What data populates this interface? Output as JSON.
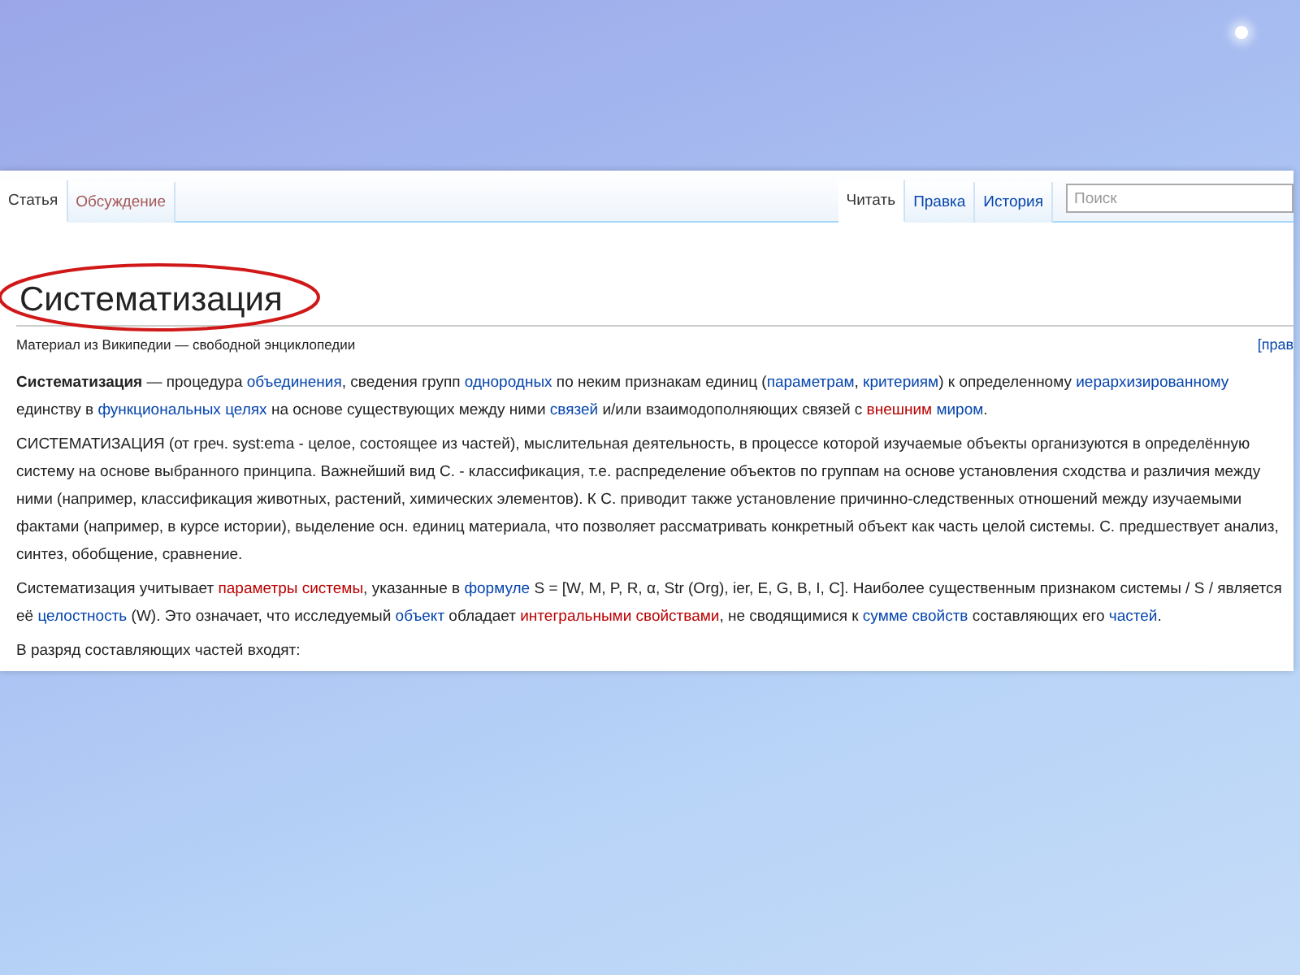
{
  "tabs_left": [
    {
      "label": "Статья",
      "selected": true
    },
    {
      "label": "Обсуждение",
      "selected": false
    }
  ],
  "tabs_right": [
    {
      "label": "Читать",
      "selected": true
    },
    {
      "label": "Правка",
      "selected": false
    },
    {
      "label": "История",
      "selected": false
    }
  ],
  "search": {
    "placeholder": "Поиск"
  },
  "title": "Систематизация",
  "subtitle": "Материал из Википедии — свободной энциклопедии",
  "edit_link": "[прав",
  "paragraphs": [
    [
      {
        "kind": "bold",
        "text": "Систематизация"
      },
      {
        "kind": "plain",
        "text": " — процедура "
      },
      {
        "kind": "link",
        "text": "объединения"
      },
      {
        "kind": "plain",
        "text": ", сведения групп "
      },
      {
        "kind": "link",
        "text": "однородных"
      },
      {
        "kind": "plain",
        "text": " по неким признакам единиц ("
      },
      {
        "kind": "link",
        "text": "параметрам"
      },
      {
        "kind": "plain",
        "text": ", "
      },
      {
        "kind": "link",
        "text": "критериям"
      },
      {
        "kind": "plain",
        "text": ") к определенному "
      },
      {
        "kind": "link",
        "text": "иерархизированному"
      },
      {
        "kind": "plain",
        "text": " единству в "
      },
      {
        "kind": "link",
        "text": "функциональных целях"
      },
      {
        "kind": "plain",
        "text": " на основе существующих между ними "
      },
      {
        "kind": "link",
        "text": "связей"
      },
      {
        "kind": "plain",
        "text": " и/или взаимодополняющих связей с "
      },
      {
        "kind": "redlink",
        "text": "внешним "
      },
      {
        "kind": "link",
        "text": "миром"
      },
      {
        "kind": "plain",
        "text": "."
      }
    ],
    [
      {
        "kind": "plain",
        "text": "СИСТЕМАТИЗАЦИЯ (от греч. syst:ema - целое, состоящее из частей), мыслительная деятельность, в процессе которой изучаемые объекты организуются в определённую систему на основе выбранного принципа. Важнейший вид С. - классификация, т.е. распределение объектов по группам на основе установления сходства и различия между ними (например, классификация животных, растений, химических элементов). К С. приводит также установление причинно-следственных отношений между изучаемыми фактами (например, в курсе истории), выделение осн. единиц материала, что позволяет рассматривать конкретный объект как часть целой системы. С. предшествует анализ, синтез, обобщение, сравнение."
      }
    ],
    [
      {
        "kind": "plain",
        "text": "Систематизация учитывает "
      },
      {
        "kind": "redlink",
        "text": "параметры системы"
      },
      {
        "kind": "plain",
        "text": ", указанные в "
      },
      {
        "kind": "link",
        "text": "формуле"
      },
      {
        "kind": "plain",
        "text": " S = [W, M, P, R, α, Str (Org), ier, E, G, B, I, C]. Наиболее существенным признаком системы / S / является её "
      },
      {
        "kind": "link",
        "text": "целостность"
      },
      {
        "kind": "plain",
        "text": " (W). Это означает, что исследуемый "
      },
      {
        "kind": "link",
        "text": "объект"
      },
      {
        "kind": "plain",
        "text": " обладает "
      },
      {
        "kind": "redlink",
        "text": "интегральными свойствами"
      },
      {
        "kind": "plain",
        "text": ", не сводящимися к "
      },
      {
        "kind": "link",
        "text": "сумме свойств"
      },
      {
        "kind": "plain",
        "text": " составляющих его "
      },
      {
        "kind": "link",
        "text": "частей"
      },
      {
        "kind": "plain",
        "text": "."
      }
    ],
    [
      {
        "kind": "plain",
        "text": "В разряд составляющих частей входят:"
      }
    ]
  ]
}
